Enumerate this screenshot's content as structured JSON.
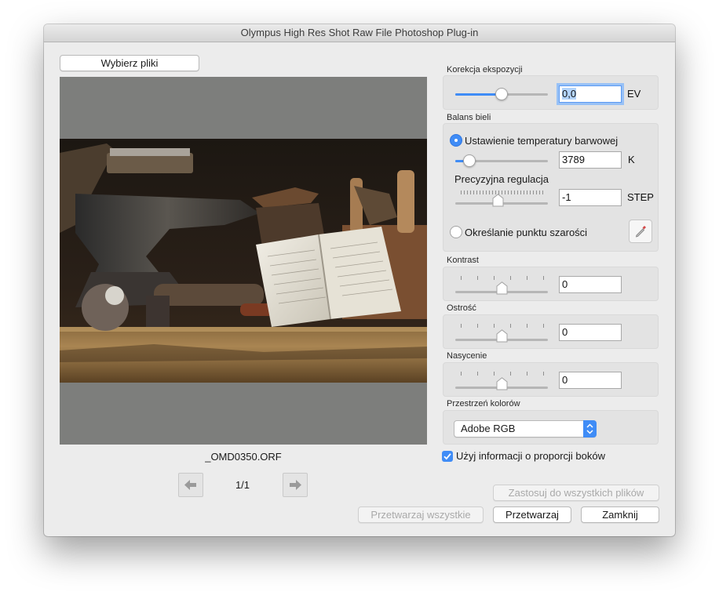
{
  "window": {
    "title": "Olympus High Res Shot Raw File Photoshop Plug-in"
  },
  "file": {
    "choose_button": "Wybierz pliki",
    "filename": "_OMD0350.ORF",
    "page_indicator": "1/1"
  },
  "exposure": {
    "title": "Korekcja ekspozycji",
    "value": "0,0",
    "unit": "EV",
    "slider_position": 0.5
  },
  "white_balance": {
    "title": "Balans bieli",
    "color_temp_option": "Ustawienie temperatury barwowej",
    "color_temp_value": "3789",
    "color_temp_unit": "K",
    "color_temp_slider_position": 0.15,
    "fine_tune_label": "Precyzyjna regulacja",
    "fine_tune_value": "-1",
    "fine_tune_unit": "STEP",
    "fine_tune_slider_position": 0.45,
    "gray_point_option": "Określanie punktu szarości"
  },
  "contrast": {
    "title": "Kontrast",
    "value": "0",
    "slider_position": 0.5
  },
  "sharpness": {
    "title": "Ostrość",
    "value": "0",
    "slider_position": 0.5
  },
  "saturation": {
    "title": "Nasycenie",
    "value": "0",
    "slider_position": 0.5
  },
  "color_space": {
    "title": "Przestrzeń kolorów",
    "selected": "Adobe RGB"
  },
  "aspect_ratio": {
    "label": "Użyj informacji o proporcji boków",
    "checked": true
  },
  "buttons": {
    "apply_all": "Zastosuj do wszystkich plików",
    "process_all": "Przetwarzaj wszystkie",
    "process": "Przetwarzaj",
    "close": "Zamknij"
  },
  "colors": {
    "accent": "#3f8cf6",
    "preview_bg": "#7d7e7c",
    "window_bg": "#ececec"
  }
}
